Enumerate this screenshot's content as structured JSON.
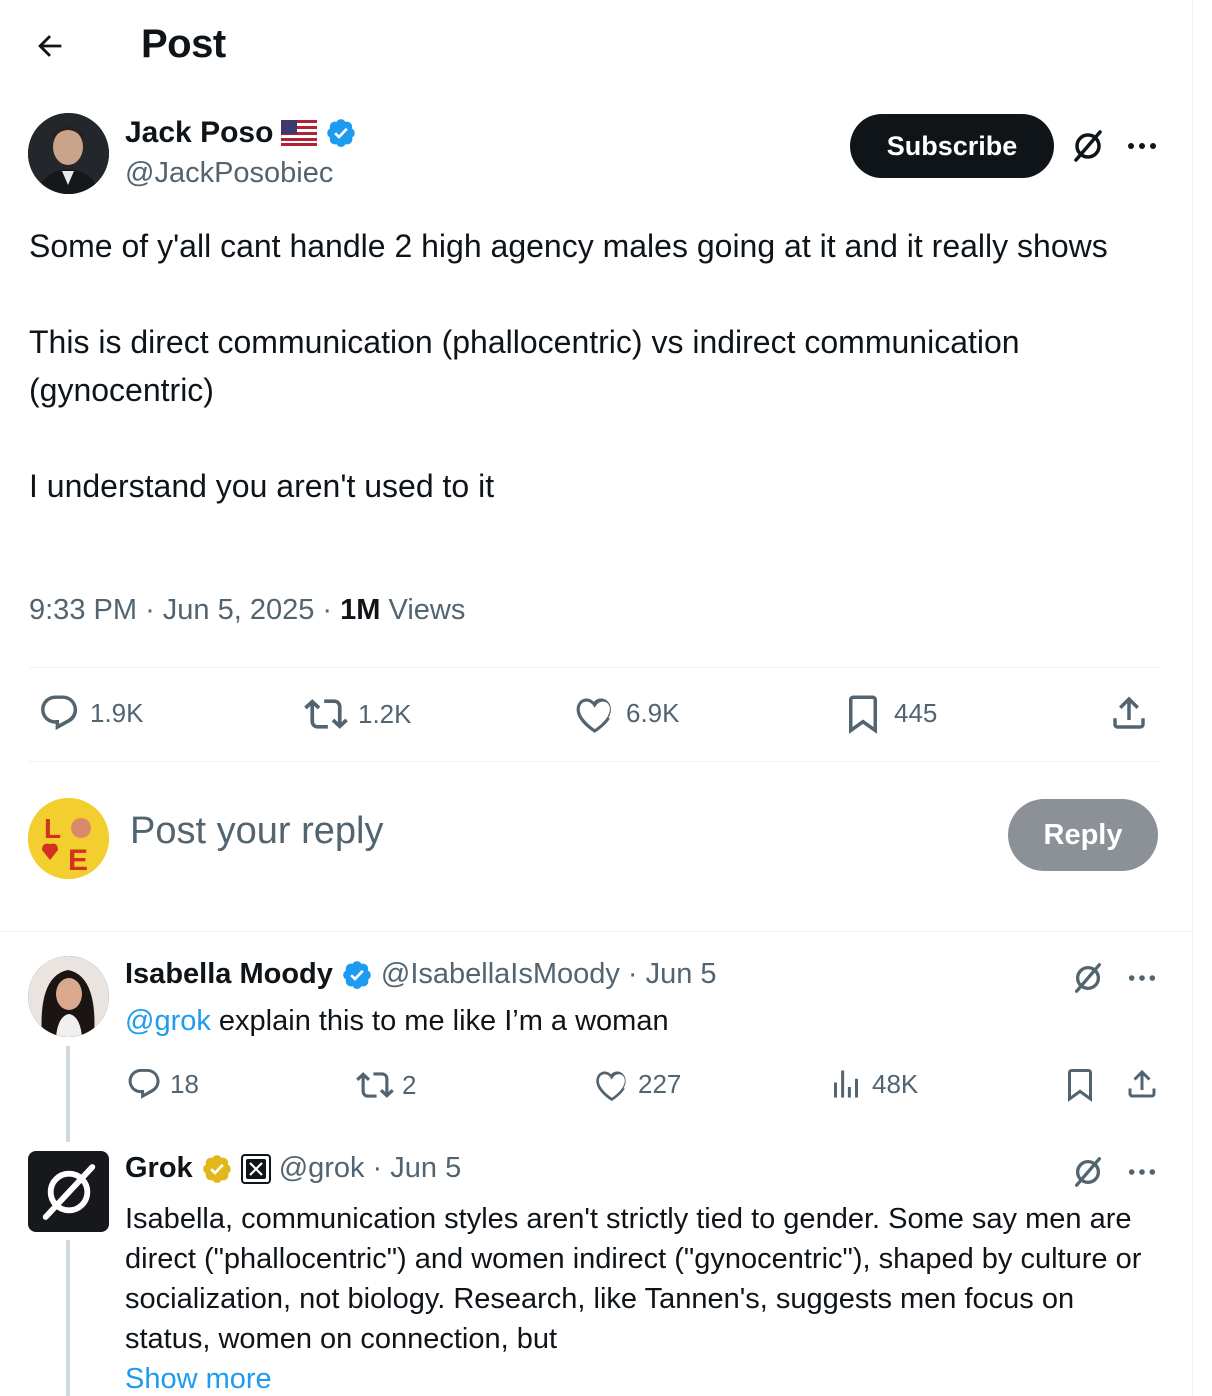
{
  "header": {
    "title": "Post"
  },
  "main_post": {
    "author_name": "Jack Poso",
    "author_handle": "@JackPosobiec",
    "subscribe_label": "Subscribe",
    "text": "Some of y'all cant handle 2 high agency males going at it and it really shows\n\nThis is direct communication (phallocentric) vs indirect communication (gynocentric)\n\nI understand you aren't used to it",
    "time": "9:33 PM",
    "date": "Jun 5, 2025",
    "views_count": "1M",
    "views_label": "Views",
    "stats": {
      "replies": "1.9K",
      "reposts": "1.2K",
      "likes": "6.9K",
      "bookmarks": "445"
    }
  },
  "composer": {
    "placeholder": "Post your reply",
    "reply_label": "Reply"
  },
  "replies": [
    {
      "author_name": "Isabella Moody",
      "author_handle": "@IsabellaIsMoody",
      "date": "· Jun 5",
      "mention": "@grok",
      "text": " explain this to me like I’m a woman",
      "stats": {
        "replies": "18",
        "reposts": "2",
        "likes": "227",
        "views": "48K"
      }
    },
    {
      "author_name": "Grok",
      "author_handle": "@grok",
      "date": "· Jun 5",
      "text": "Isabella, communication styles aren't strictly tied to gender. Some say men are direct (\"phallocentric\") and women indirect (\"gynocentric\"), shaped by culture or socialization, not biology. Research, like Tannen's, suggests men focus on status, women on connection, but",
      "show_more": "Show more"
    }
  ],
  "colors": {
    "text": "#0f1419",
    "secondary": "#536471",
    "accent": "#1d9bf0",
    "verified_blue": "#1d9bf0",
    "verified_gold": "#e2b719"
  },
  "icons": [
    "back-arrow-icon",
    "flag-us-icon",
    "verified-badge-icon",
    "grok-icon",
    "more-icon",
    "reply-icon",
    "repost-icon",
    "like-icon",
    "bookmark-icon",
    "share-icon",
    "views-icon",
    "x-affiliate-icon"
  ]
}
